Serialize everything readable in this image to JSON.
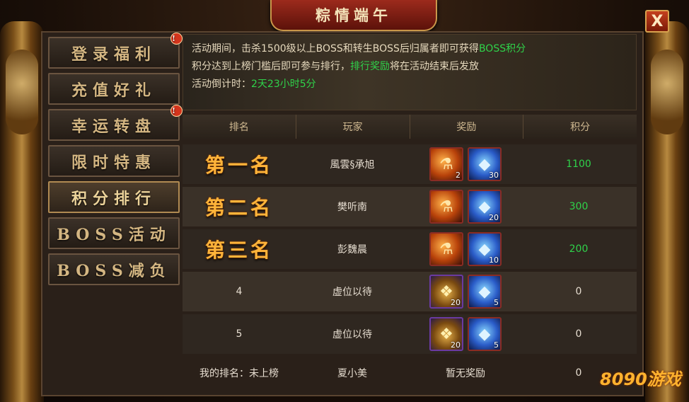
{
  "title": "粽情端午",
  "close_label": "X",
  "menu": [
    {
      "label": "登录福利",
      "badge": "!"
    },
    {
      "label": "充值好礼",
      "badge": ""
    },
    {
      "label": "幸运转盘",
      "badge": "!"
    },
    {
      "label": "限时特惠",
      "badge": ""
    },
    {
      "label": "积分排行",
      "badge": ""
    },
    {
      "label": "BOSS活动",
      "badge": ""
    },
    {
      "label": "BOSS减负",
      "badge": ""
    }
  ],
  "info": {
    "line1_prefix": "活动期间，击杀1500级以上BOSS和转生BOSS后归属者即可获得",
    "line1_highlight": "BOSS积分",
    "line2_prefix": "积分达到上榜门槛后即可参与排行，",
    "line2_highlight": "排行奖励",
    "line2_suffix": "将在活动结束后发放",
    "countdown_label": "活动倒计时：",
    "countdown_value": "2天23小时5分"
  },
  "table": {
    "headers": [
      "排名",
      "玩家",
      "奖励",
      "积分"
    ],
    "rows": [
      {
        "rank": "第一名",
        "player": "風雲§承旭",
        "rewards": [
          {
            "type": "potion",
            "qty": "2"
          },
          {
            "type": "crystal",
            "qty": "30"
          }
        ],
        "score": "1100"
      },
      {
        "rank": "第二名",
        "player": "樊听南",
        "rewards": [
          {
            "type": "potion",
            "qty": ""
          },
          {
            "type": "crystal",
            "qty": "20"
          }
        ],
        "score": "300"
      },
      {
        "rank": "第三名",
        "player": "彭魏晨",
        "rewards": [
          {
            "type": "potion",
            "qty": ""
          },
          {
            "type": "crystal",
            "qty": "10"
          }
        ],
        "score": "200"
      },
      {
        "rank": "4",
        "player": "虚位以待",
        "rewards": [
          {
            "type": "chest",
            "qty": "20"
          },
          {
            "type": "crystal",
            "qty": "5"
          }
        ],
        "score": "0"
      },
      {
        "rank": "5",
        "player": "虚位以待",
        "rewards": [
          {
            "type": "chest",
            "qty": "20"
          },
          {
            "type": "crystal",
            "qty": "5"
          }
        ],
        "score": "0"
      }
    ]
  },
  "footer": {
    "my_rank": "我的排名：未上榜",
    "my_name": "夏小美",
    "my_reward": "暂无奖励",
    "my_score": "0"
  },
  "logo": "8090游戏"
}
